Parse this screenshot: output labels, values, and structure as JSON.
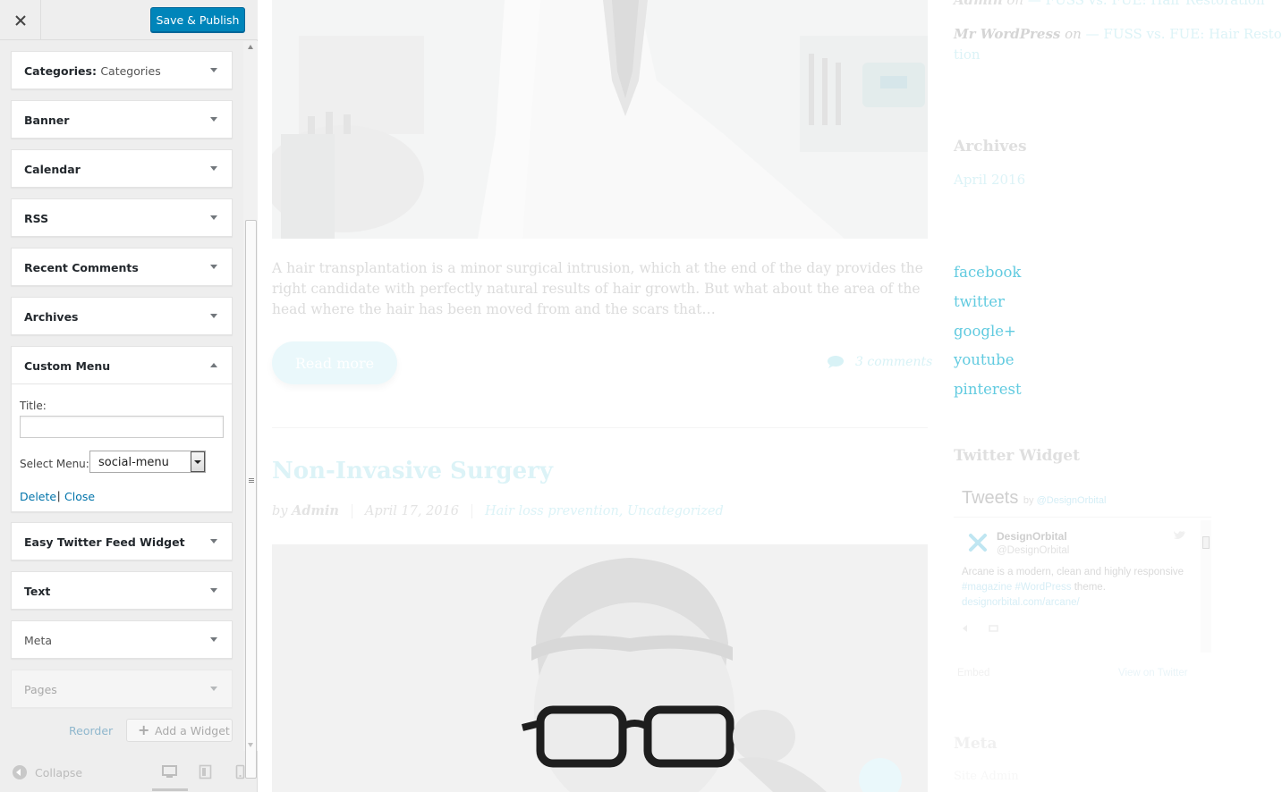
{
  "sidebar": {
    "close_label": "×",
    "save_publish": "Save & Publish",
    "widgets": [
      {
        "label": "Categories:",
        "sub": "Categories"
      },
      {
        "label": "Banner"
      },
      {
        "label": "Calendar"
      },
      {
        "label": "RSS"
      },
      {
        "label": "Recent Comments"
      },
      {
        "label": "Archives"
      },
      {
        "label": "Custom Menu"
      },
      {
        "label": "Easy Twitter Feed Widget"
      },
      {
        "label": "Text"
      },
      {
        "label": "Meta"
      },
      {
        "label": "Pages"
      }
    ],
    "custom_menu_form": {
      "title_label": "Title:",
      "title_value": "",
      "select_label": "Select Menu:",
      "select_value": "social-menu",
      "delete": "Delete",
      "separator": "|",
      "close": "Close"
    },
    "reorder": "Reorder",
    "add_widget": "Add a Widget",
    "collapse": "Collapse",
    "devices": [
      "desktop-icon",
      "tablet-icon",
      "mobile-icon"
    ],
    "colors": {
      "primary": "#0085ba",
      "link": "#0073aa"
    }
  },
  "preview": {
    "excerpt": "A hair transplantation is a minor surgical intrusion, which at the end of the day provides the right candidate with perfectly natural results of hair growth. But what about  the area of the head where the hair has been moved from and the scars that…",
    "read_more": "Read more",
    "comments": "3 comments",
    "post_title": "Non-Invasive Surgery",
    "meta": {
      "by": "by",
      "author": "Admin",
      "date": "April 17, 2016",
      "categories": "Hair loss prevention, Uncategorized"
    },
    "sidebar": {
      "recent_comments": [
        {
          "author": "Admin",
          "on": "on",
          "dash": "—",
          "post": "FUSS vs. FUE: Hair Restoration"
        },
        {
          "author": "Mr WordPress",
          "on": "on",
          "dash": "—",
          "post_line1": "FUSS vs. FUE: Hair Restora-",
          "post_line2": "tion"
        }
      ],
      "archives_title": "Archives",
      "archive_item": "April 2016",
      "social_links": [
        "facebook",
        "twitter",
        "google+",
        "youtube",
        "pinterest"
      ],
      "twitter_widget_title": "Twitter Widget",
      "tweets": {
        "header": "Tweets",
        "by": "by",
        "handle_link": "@DesignOrbital",
        "name": "DesignOrbital",
        "handle": "@DesignOrbital",
        "text_1": "Arcane is a modern, clean and highly responsive",
        "hashtag_1": "#magazine",
        "hashtag_2": "#WordPress",
        "text_2": "theme.",
        "url": "designorbital.com/arcane/",
        "embed": "Embed",
        "view_on": "View on Twitter"
      },
      "meta_title": "Meta",
      "meta_item": "Site Admin"
    }
  }
}
